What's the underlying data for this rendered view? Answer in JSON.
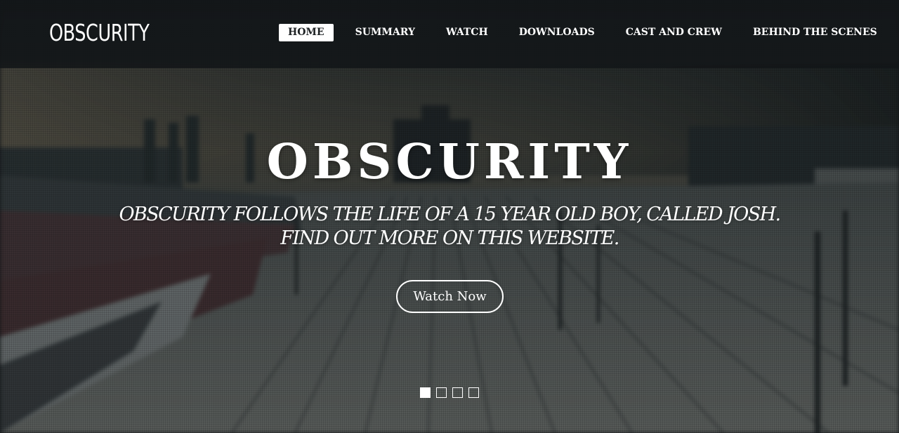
{
  "brand": {
    "logo": "OBSCURITY"
  },
  "nav": {
    "items": [
      {
        "label": "HOME",
        "active": true
      },
      {
        "label": "SUMMARY",
        "active": false
      },
      {
        "label": "WATCH",
        "active": false
      },
      {
        "label": "DOWNLOADS",
        "active": false
      },
      {
        "label": "CAST AND CREW",
        "active": false
      },
      {
        "label": "BEHIND THE SCENES",
        "active": false
      }
    ]
  },
  "hero": {
    "title": "OBSCURITY",
    "subtitle_line1": "OBSCURITY FOLLOWS THE LIFE OF A 15 YEAR OLD BOY, CALLED JOSH.",
    "subtitle_line2": "FIND OUT MORE ON THIS WEBSITE.",
    "cta_label": "Watch Now"
  },
  "slider": {
    "slide_count": 4,
    "active_index": 0
  },
  "colors": {
    "header_bg": "#121618",
    "text": "#ffffff",
    "active_nav_text": "#1e2224"
  }
}
